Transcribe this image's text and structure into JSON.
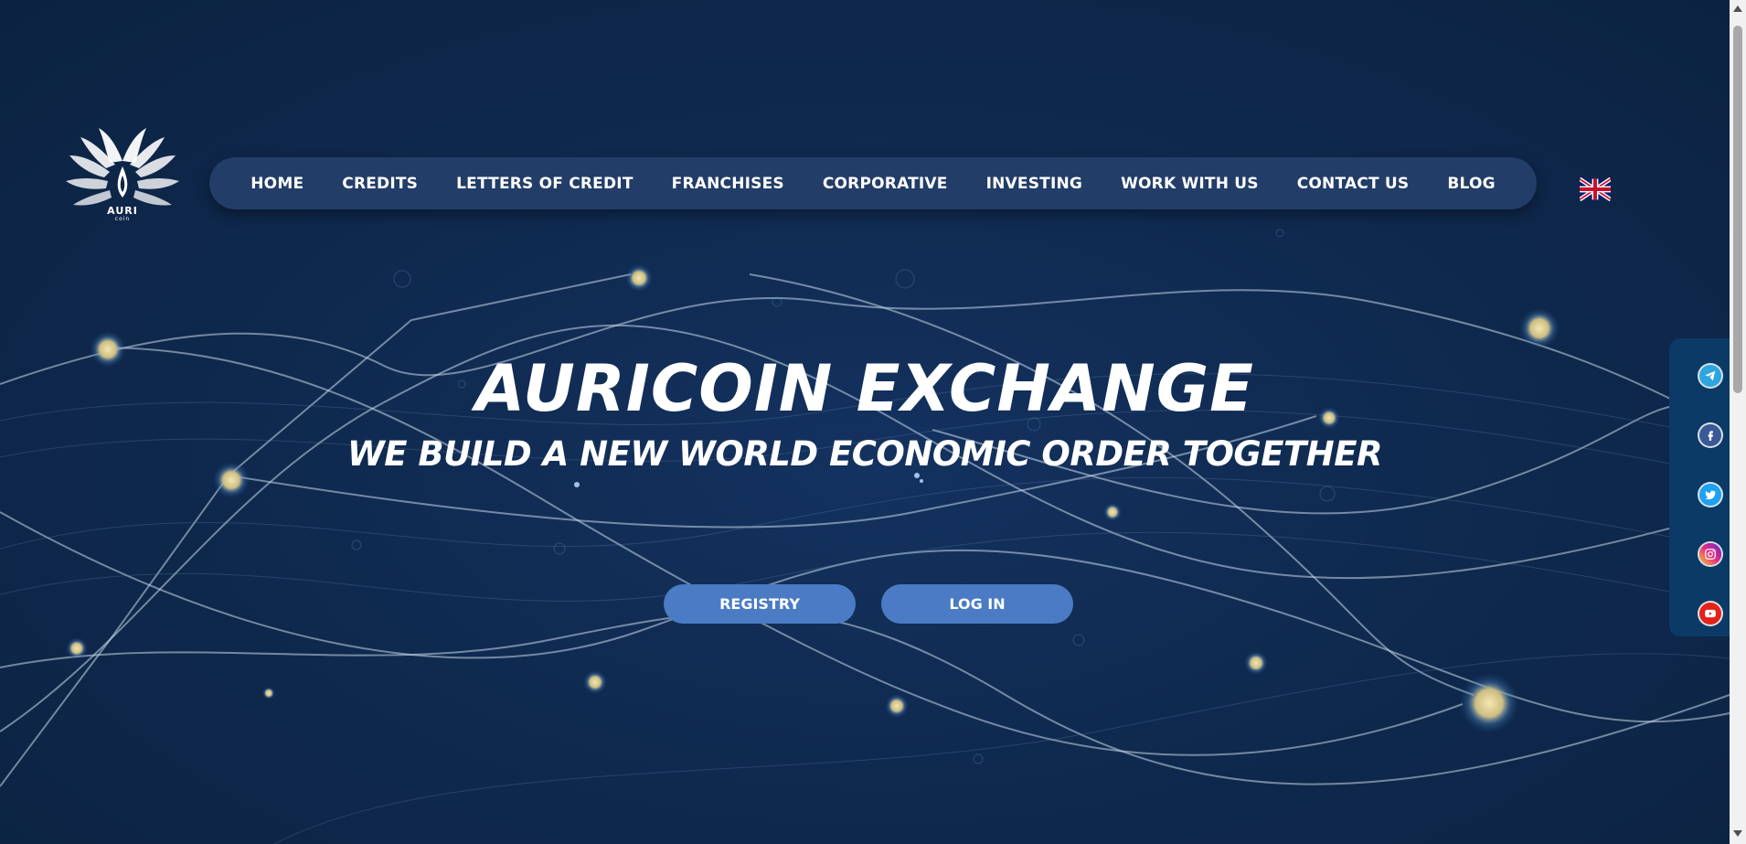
{
  "logo": {
    "name": "auricoin-logo",
    "text_main": "AURI",
    "text_sub": "coin"
  },
  "nav": {
    "items": [
      {
        "label": "HOME"
      },
      {
        "label": "CREDITS"
      },
      {
        "label": "LETTERS OF CREDIT"
      },
      {
        "label": "FRANCHISES"
      },
      {
        "label": "CORPORATIVE"
      },
      {
        "label": "INVESTING"
      },
      {
        "label": "WORK WITH US"
      },
      {
        "label": "CONTACT US"
      },
      {
        "label": "BLOG"
      }
    ]
  },
  "language": {
    "icon": "uk-flag-icon"
  },
  "hero": {
    "title": "AURICOIN EXCHANGE",
    "subtitle": "WE BUILD A NEW WORLD ECONOMIC ORDER TOGETHER"
  },
  "buttons": {
    "registry": "REGISTRY",
    "login": "LOG IN"
  },
  "social": {
    "items": [
      {
        "icon": "telegram-icon",
        "color": "#2ca5e0"
      },
      {
        "icon": "facebook-icon",
        "color": "#3b5998"
      },
      {
        "icon": "twitter-icon",
        "color": "#1da1f2"
      },
      {
        "icon": "instagram-icon",
        "color": "#c13584"
      },
      {
        "icon": "youtube-icon",
        "color": "#e62117"
      }
    ]
  },
  "colors": {
    "background": "#0f2747",
    "nav_bar": "#223d68",
    "button": "#4a7bc4",
    "social_panel": "#0b3a66",
    "accent_gold": "#d8c98d"
  }
}
